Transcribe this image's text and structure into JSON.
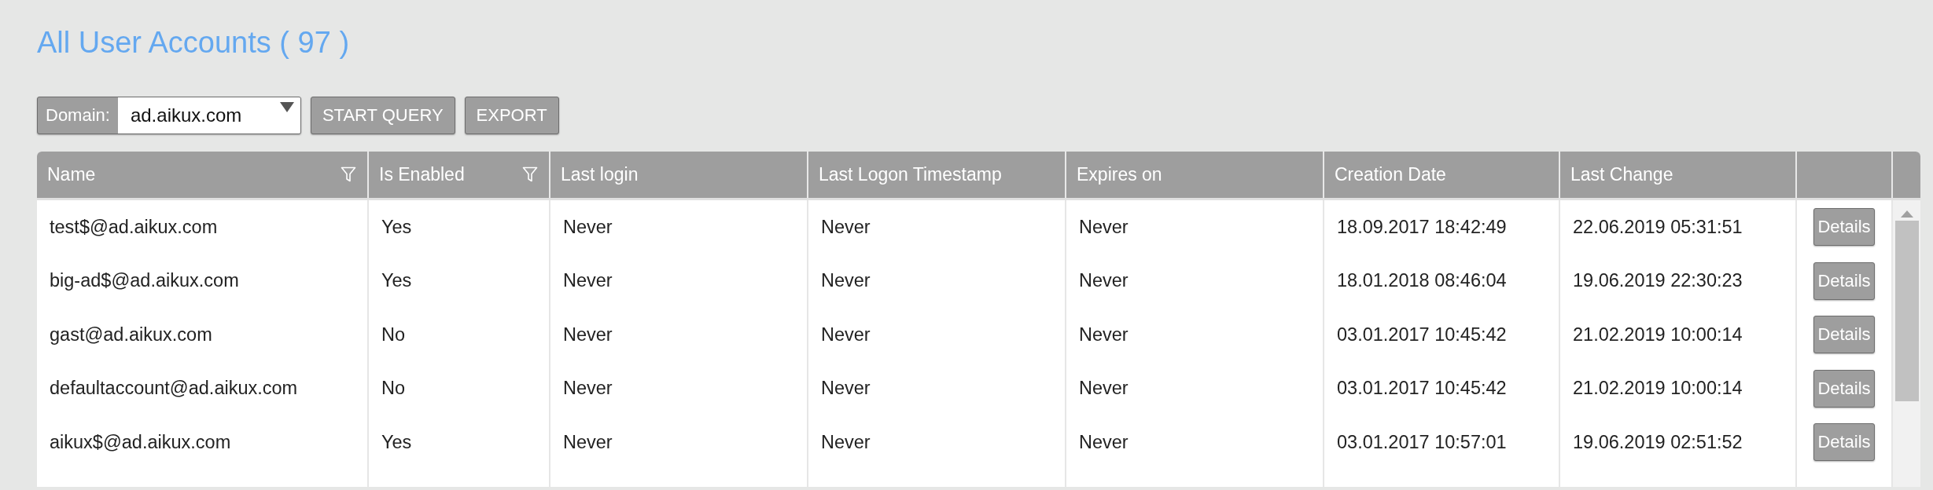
{
  "title": "All User Accounts ( 97 )",
  "toolbar": {
    "domain_label": "Domain:",
    "domain_value": "ad.aikux.com",
    "buttons": [
      "START QUERY",
      "EXPORT"
    ]
  },
  "table": {
    "columns": [
      {
        "label": "Name",
        "filter": true
      },
      {
        "label": "Is Enabled",
        "filter": true
      },
      {
        "label": "Last login",
        "filter": false
      },
      {
        "label": "Last Logon Timestamp",
        "filter": false
      },
      {
        "label": "Expires on",
        "filter": false
      },
      {
        "label": "Creation Date",
        "filter": false
      },
      {
        "label": "Last Change",
        "filter": false
      }
    ],
    "rows": [
      {
        "cells": [
          "test$@ad.aikux.com",
          "Yes",
          "Never",
          "Never",
          "Never",
          "18.09.2017 18:42:49",
          "22.06.2019 05:31:51"
        ],
        "action": "Details"
      },
      {
        "cells": [
          "big-ad$@ad.aikux.com",
          "Yes",
          "Never",
          "Never",
          "Never",
          "18.01.2018 08:46:04",
          "19.06.2019 22:30:23"
        ],
        "action": "Details"
      },
      {
        "cells": [
          "gast@ad.aikux.com",
          "No",
          "Never",
          "Never",
          "Never",
          "03.01.2017 10:45:42",
          "21.02.2019 10:00:14"
        ],
        "action": "Details"
      },
      {
        "cells": [
          "defaultaccount@ad.aikux.com",
          "No",
          "Never",
          "Never",
          "Never",
          "03.01.2017 10:45:42",
          "21.02.2019 10:00:14"
        ],
        "action": "Details"
      },
      {
        "cells": [
          "aikux$@ad.aikux.com",
          "Yes",
          "Never",
          "Never",
          "Never",
          "03.01.2017 10:57:01",
          "19.06.2019 02:51:52"
        ],
        "action": "Details"
      }
    ]
  }
}
